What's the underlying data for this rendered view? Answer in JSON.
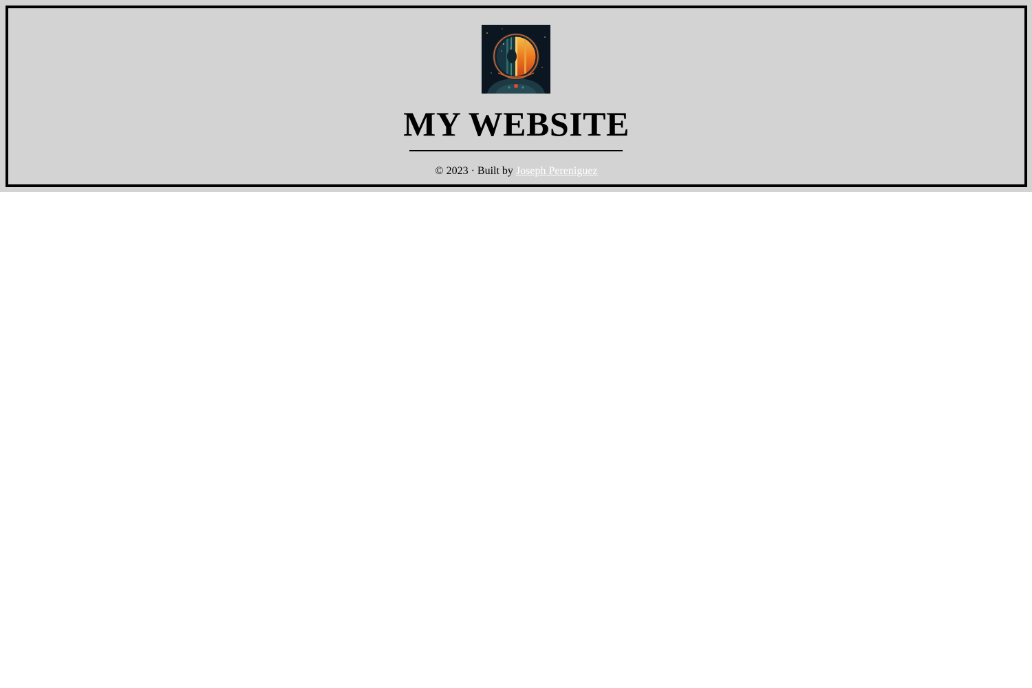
{
  "header": {
    "title": "MY WEBSITE",
    "avatar_icon": "astronaut-helmet-icon",
    "footer": {
      "copyright": "© 2023 · Built by",
      "author_link": "Joseph Pereniguez"
    }
  },
  "colors": {
    "header_background": "#d3d3d3",
    "border": "#000000",
    "page_background": "#ffffff",
    "link": "#ffffff"
  }
}
